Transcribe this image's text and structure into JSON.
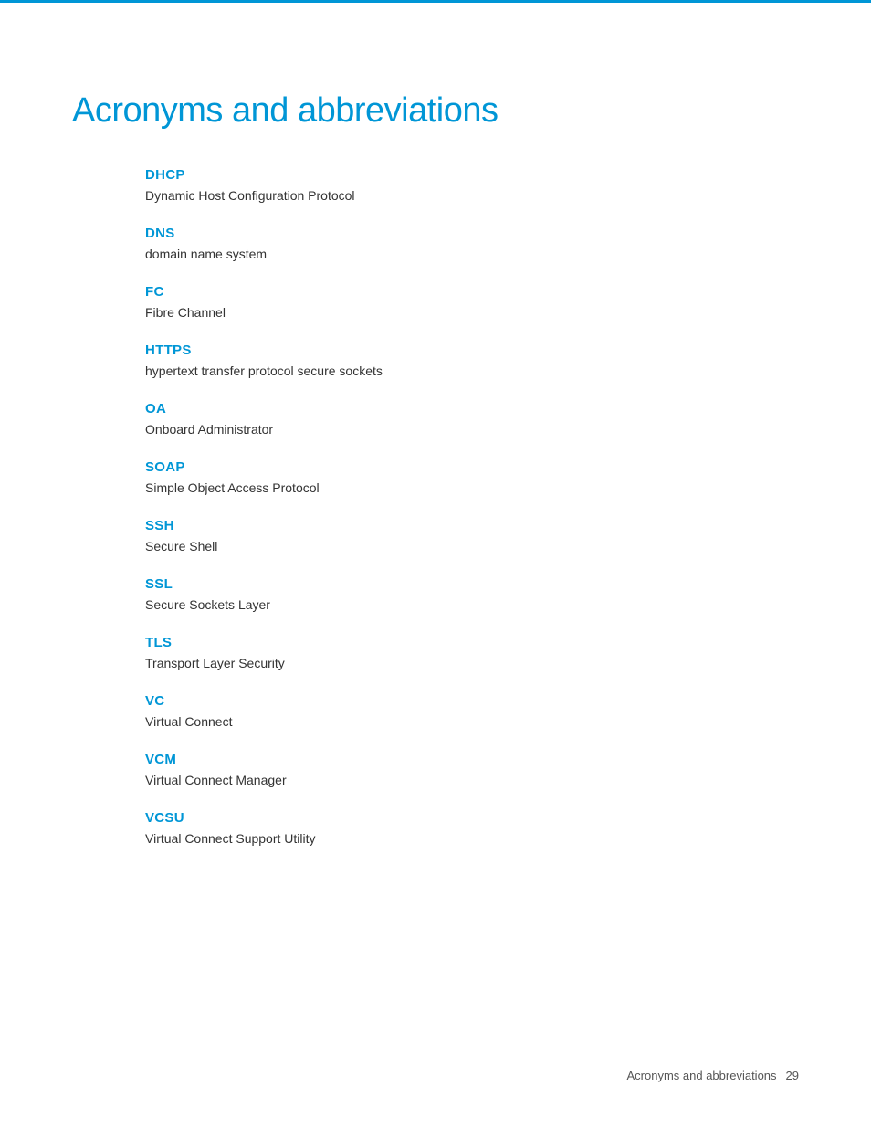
{
  "page": {
    "title": "Acronyms and abbreviations",
    "accent_color": "#0096d6",
    "footer": {
      "label": "Acronyms and abbreviations",
      "page_number": "29"
    }
  },
  "acronyms": [
    {
      "term": "DHCP",
      "definition": "Dynamic Host Configuration Protocol"
    },
    {
      "term": "DNS",
      "definition": "domain name system"
    },
    {
      "term": "FC",
      "definition": "Fibre Channel"
    },
    {
      "term": "HTTPS",
      "definition": "hypertext transfer protocol secure sockets"
    },
    {
      "term": "OA",
      "definition": "Onboard Administrator"
    },
    {
      "term": "SOAP",
      "definition": "Simple Object Access Protocol"
    },
    {
      "term": "SSH",
      "definition": "Secure Shell"
    },
    {
      "term": "SSL",
      "definition": "Secure Sockets Layer"
    },
    {
      "term": "TLS",
      "definition": "Transport Layer Security"
    },
    {
      "term": "VC",
      "definition": "Virtual Connect"
    },
    {
      "term": "VCM",
      "definition": "Virtual Connect Manager"
    },
    {
      "term": "VCSU",
      "definition": "Virtual Connect Support Utility"
    }
  ]
}
